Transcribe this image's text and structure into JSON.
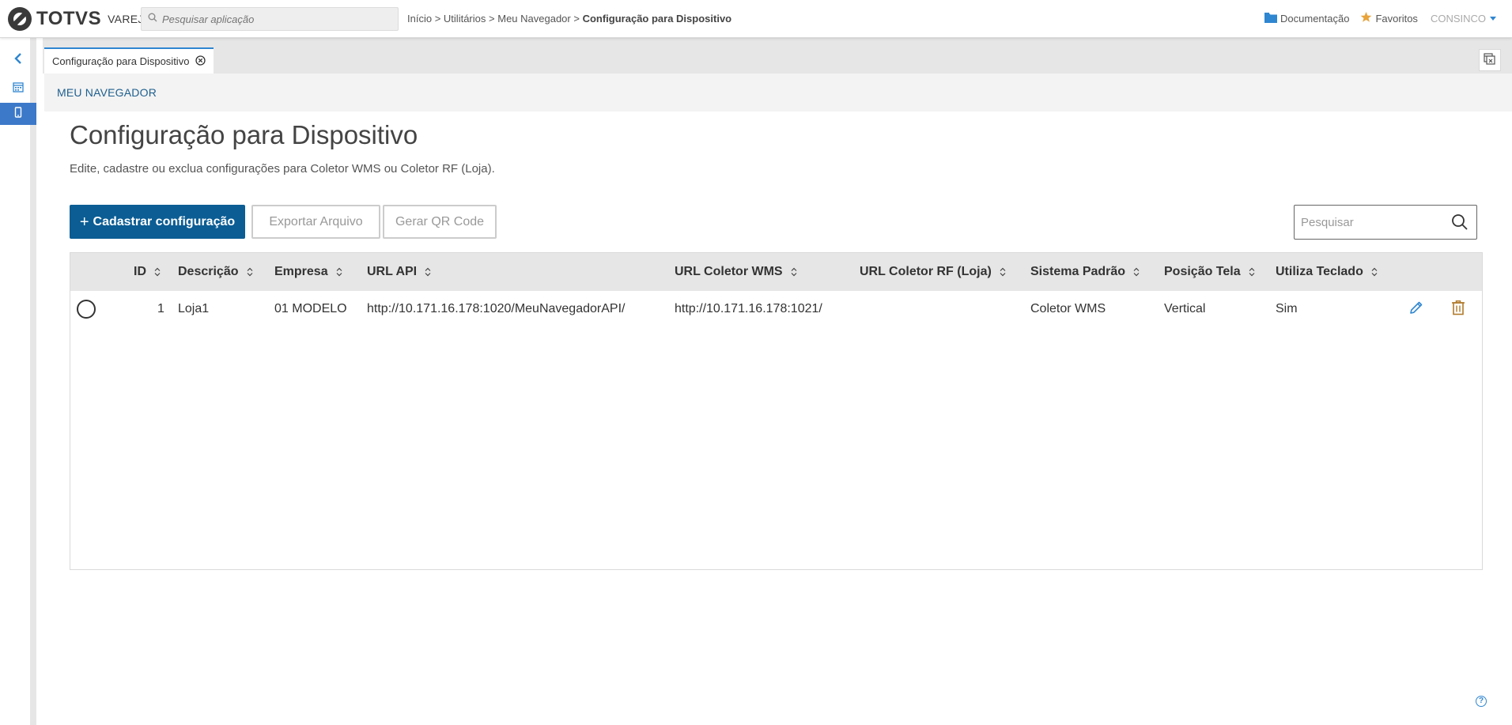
{
  "brand": {
    "name": "TOTVS",
    "sub": "VAREJO"
  },
  "app_search": {
    "placeholder": "Pesquisar aplicação"
  },
  "breadcrumb": {
    "items": [
      "Início",
      "Utilitários",
      "Meu Navegador"
    ],
    "separator": ">",
    "current": "Configuração para Dispositivo"
  },
  "header_links": {
    "docs": "Documentação",
    "favorites": "Favoritos",
    "user": "CONSINCO"
  },
  "tab": {
    "label": "Configuração para Dispositivo"
  },
  "section": {
    "title": "MEU NAVEGADOR"
  },
  "page": {
    "title": "Configuração para Dispositivo",
    "description": "Edite, cadastre ou exclua configurações para Coletor WMS ou Coletor RF (Loja)."
  },
  "actions": {
    "add_label": "Cadastrar configuração",
    "add_icon": "+",
    "export_label": "Exportar Arquivo",
    "qr_label": "Gerar QR Code"
  },
  "table_search": {
    "placeholder": "Pesquisar"
  },
  "table": {
    "columns": [
      "ID",
      "Descrição",
      "Empresa",
      "URL API",
      "URL Coletor WMS",
      "URL Coletor RF (Loja)",
      "Sistema Padrão",
      "Posição Tela",
      "Utiliza Teclado"
    ],
    "rows": [
      {
        "id": "1",
        "descricao": "Loja1",
        "empresa": "01 MODELO",
        "url_api": "http://10.171.16.178:1020/MeuNavegadorAPI/",
        "url_wms": "http://10.171.16.178:1021/",
        "url_rf": "",
        "sistema": "Coletor WMS",
        "posicao": "Vertical",
        "teclado": "Sim"
      }
    ]
  },
  "help": {
    "label": "?"
  },
  "colors": {
    "primary": "#0b5d94",
    "accent": "#2f86d1",
    "edit": "#2f86d1",
    "delete": "#b07a2a",
    "star": "#e8a33a"
  }
}
